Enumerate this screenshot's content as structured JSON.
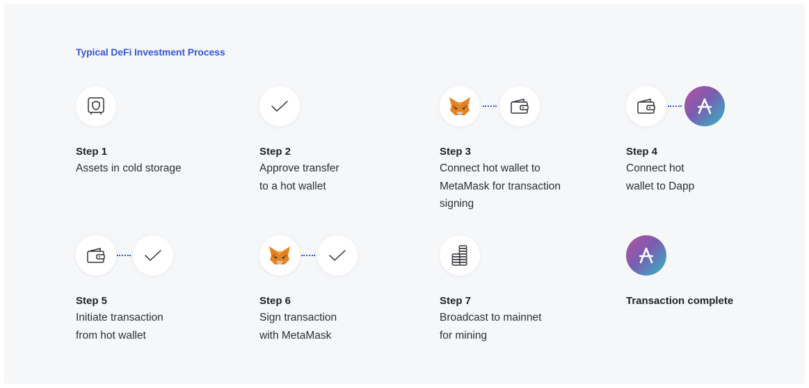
{
  "title": "Typical DeFi Investment Process",
  "steps": [
    {
      "label": "Step 1",
      "lines": [
        "Assets in cold storage"
      ],
      "icons": [
        "safe-icon"
      ]
    },
    {
      "label": "Step 2",
      "lines": [
        "Approve transfer",
        "to a hot wallet"
      ],
      "icons": [
        "check-icon"
      ]
    },
    {
      "label": "Step 3",
      "lines": [
        "Connect hot wallet to",
        "MetaMask for transaction",
        "signing"
      ],
      "icons": [
        "metamask-fox-icon",
        "wallet-icon"
      ]
    },
    {
      "label": "Step 4",
      "lines": [
        "Connect hot",
        "wallet to Dapp"
      ],
      "icons": [
        "wallet-icon",
        "aave-logo-icon"
      ]
    },
    {
      "label": "Step 5",
      "lines": [
        "Initiate transaction",
        "from hot wallet"
      ],
      "icons": [
        "wallet-icon",
        "check-icon"
      ]
    },
    {
      "label": "Step 6",
      "lines": [
        "Sign transaction",
        "with MetaMask"
      ],
      "icons": [
        "metamask-fox-icon",
        "check-icon"
      ]
    },
    {
      "label": "Step 7",
      "lines": [
        "Broadcast to mainnet",
        "for mining"
      ],
      "icons": [
        "coin-stack-icon"
      ]
    },
    {
      "label": "Transaction complete",
      "lines": [],
      "icons": [
        "aave-logo-icon"
      ]
    }
  ],
  "colors": {
    "accent": "#3355dd",
    "text": "#2a2d33",
    "background": "#f6f7f9",
    "fox": "#e8821e"
  }
}
